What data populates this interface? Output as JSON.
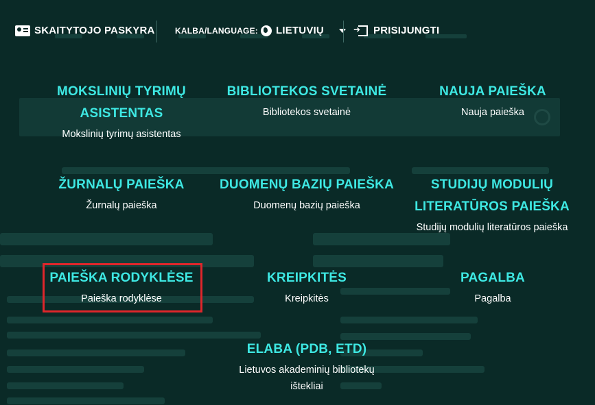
{
  "header": {
    "account_label": "SKAITYTOJO PASKYRA",
    "language_label": "KALBA/LANGUAGE:",
    "language_value": "LIETUVIŲ",
    "login_label": "PRISIJUNGTI"
  },
  "menu": [
    {
      "title_line1": "MOKSLINIŲ TYRIMŲ",
      "title_line2": "ASISTENTAS",
      "subtitle": "Mokslinių tyrimų asistentas"
    },
    {
      "title_line1": "BIBLIOTEKOS SVETAINĖ",
      "subtitle": "Bibliotekos svetainė"
    },
    {
      "title_line1": "NAUJA PAIEŠKA",
      "subtitle": "Nauja paieška"
    },
    {
      "title_line1": "ŽURNALŲ PAIEŠKA",
      "subtitle": "Žurnalų paieška"
    },
    {
      "title_line1": "DUOMENŲ BAZIŲ PAIEŠKA",
      "subtitle": "Duomenų bazių paieška"
    },
    {
      "title_line1": "STUDIJŲ MODULIŲ",
      "title_line2": "LITERATŪROS PAIEŠKA",
      "subtitle": "Studijų modulių literatūros paieška"
    },
    {
      "title_line1": "PAIEŠKA RODYKLĖSE",
      "subtitle": "Paieška rodyklėse"
    },
    {
      "title_line1": "KREIPKITĖS",
      "subtitle": "Kreipkitės"
    },
    {
      "title_line1": "PAGALBA",
      "subtitle": "Pagalba"
    },
    {
      "title_line1": "ELABA (PDB, ETD)",
      "subtitle_line1": "Lietuvos akademinių bibliotekų",
      "subtitle_line2": "ištekliai"
    }
  ],
  "colors": {
    "background": "#0a2a27",
    "link": "#3ee8e3",
    "highlight": "#e0262b"
  },
  "icons": {
    "account": "id-card-icon",
    "language": "globe-icon",
    "dropdown": "chevron-down-icon",
    "login": "login-icon"
  }
}
